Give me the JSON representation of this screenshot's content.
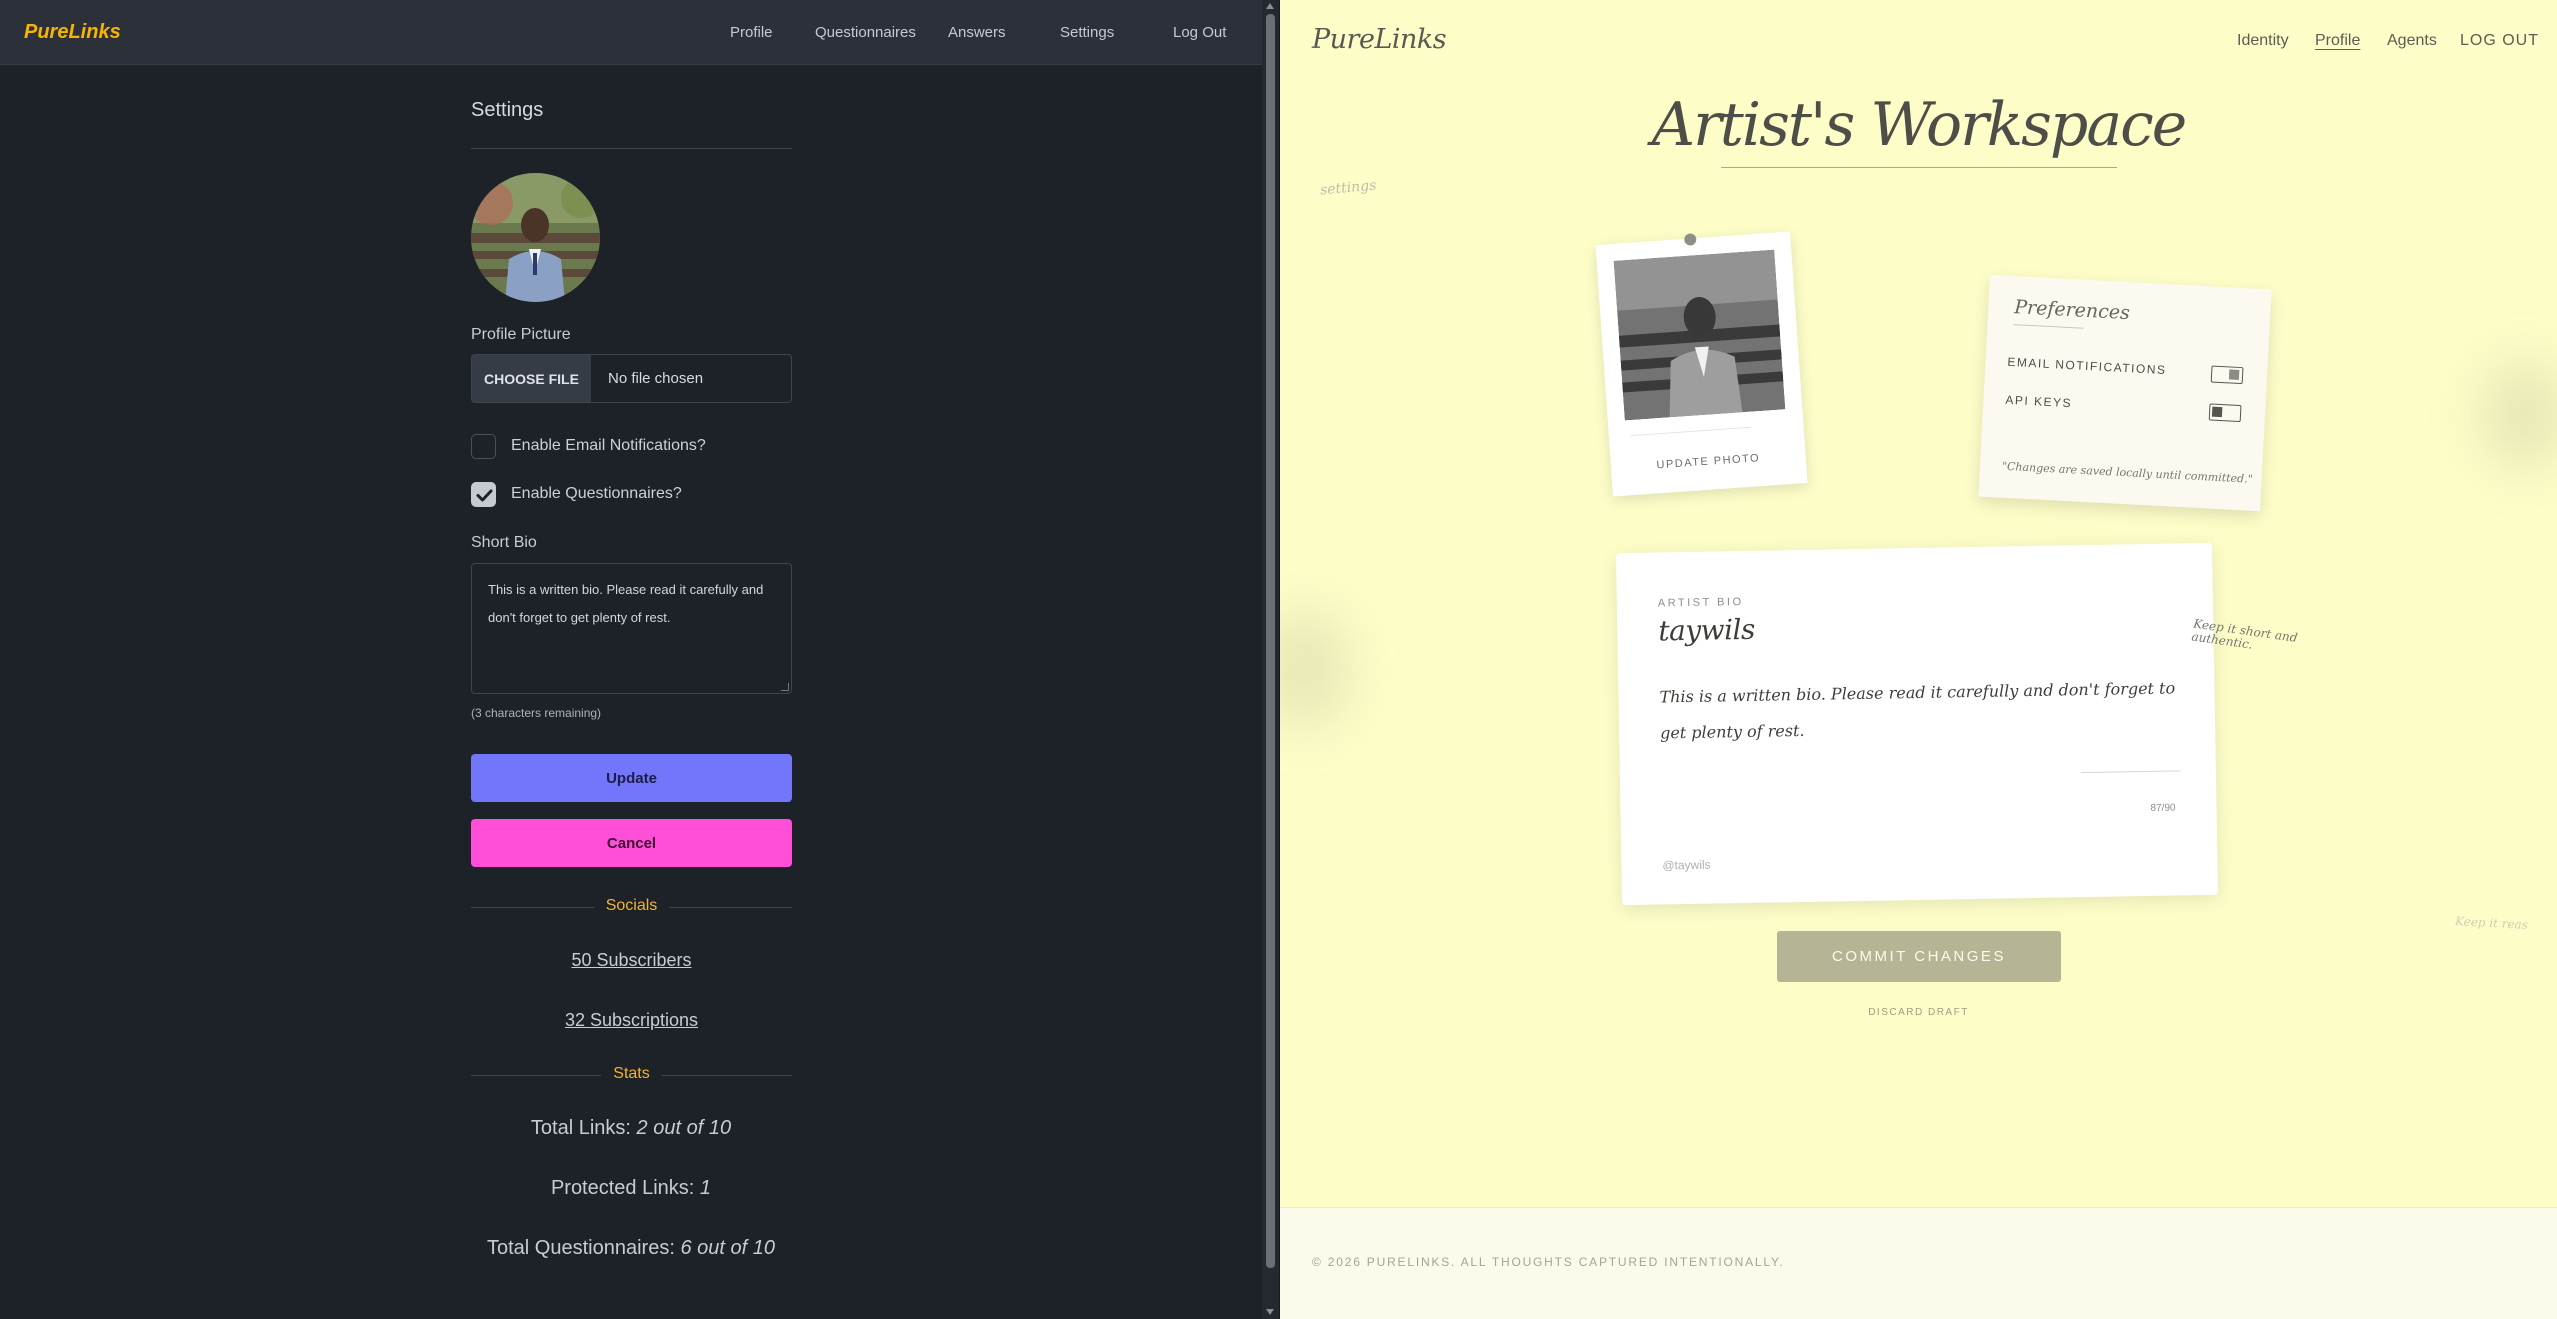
{
  "left_app": {
    "brand": "PureLinks",
    "nav": [
      "Profile",
      "Questionnaires",
      "Answers",
      "Settings",
      "Log Out"
    ],
    "page_title": "Settings",
    "profile_picture_label": "Profile Picture",
    "file_button": "CHOOSE FILE",
    "file_status": "No file chosen",
    "checkboxes": [
      {
        "label": "Enable Email Notifications?",
        "checked": false
      },
      {
        "label": "Enable Questionnaires?",
        "checked": true
      }
    ],
    "short_bio_label": "Short Bio",
    "short_bio_value": "This is a written bio. Please read it carefully and don't forget to get plenty of rest.",
    "chars_remaining": "(3 characters remaining)",
    "update_label": "Update",
    "cancel_label": "Cancel",
    "socials_heading": "Socials",
    "subscribers": "50 Subscribers",
    "subscriptions": "32 Subscriptions",
    "stats_heading": "Stats",
    "stats": [
      {
        "label": "Total Links:",
        "value": "2 out of 10"
      },
      {
        "label": "Protected Links:",
        "value": "1"
      },
      {
        "label": "Total Questionnaires:",
        "value": "6 out of 10"
      }
    ],
    "colors": {
      "background": "#1d2128",
      "brand": "#f7b500",
      "update": "#7276fa",
      "cancel": "#ff4fd8",
      "section_heading": "#f2b531"
    }
  },
  "right_app": {
    "brand": "PureLinks",
    "nav": [
      "Identity",
      "Profile",
      "Agents",
      "LOG OUT"
    ],
    "active_nav": "Profile",
    "workspace_title": "Artist's Workspace",
    "settings_note": "settings",
    "update_photo": "UPDATE PHOTO",
    "preferences": {
      "title": "Preferences",
      "rows": [
        {
          "label": "EMAIL NOTIFICATIONS",
          "on": false
        },
        {
          "label": "API KEYS",
          "on": false
        }
      ],
      "note": "\"Changes are saved locally until committed.\""
    },
    "bio_card": {
      "label": "ARTIST BIO",
      "username": "taywils",
      "bio": "This is a written bio. Please read it carefully and don't forget to get plenty of rest.",
      "count": "87/90",
      "handle": "@taywils"
    },
    "side_note": "Keep it short and authentic.",
    "faint_note": "Keep it reas",
    "commit_label": "COMMIT CHANGES",
    "discard_label": "DISCARD DRAFT",
    "footer": "© 2026 PURELINKS. ALL THOUGHTS CAPTURED INTENTIONALLY.",
    "colors": {
      "background": "#fdfdc8",
      "commit": "#b5b595",
      "ink": "#4e4e48"
    }
  }
}
